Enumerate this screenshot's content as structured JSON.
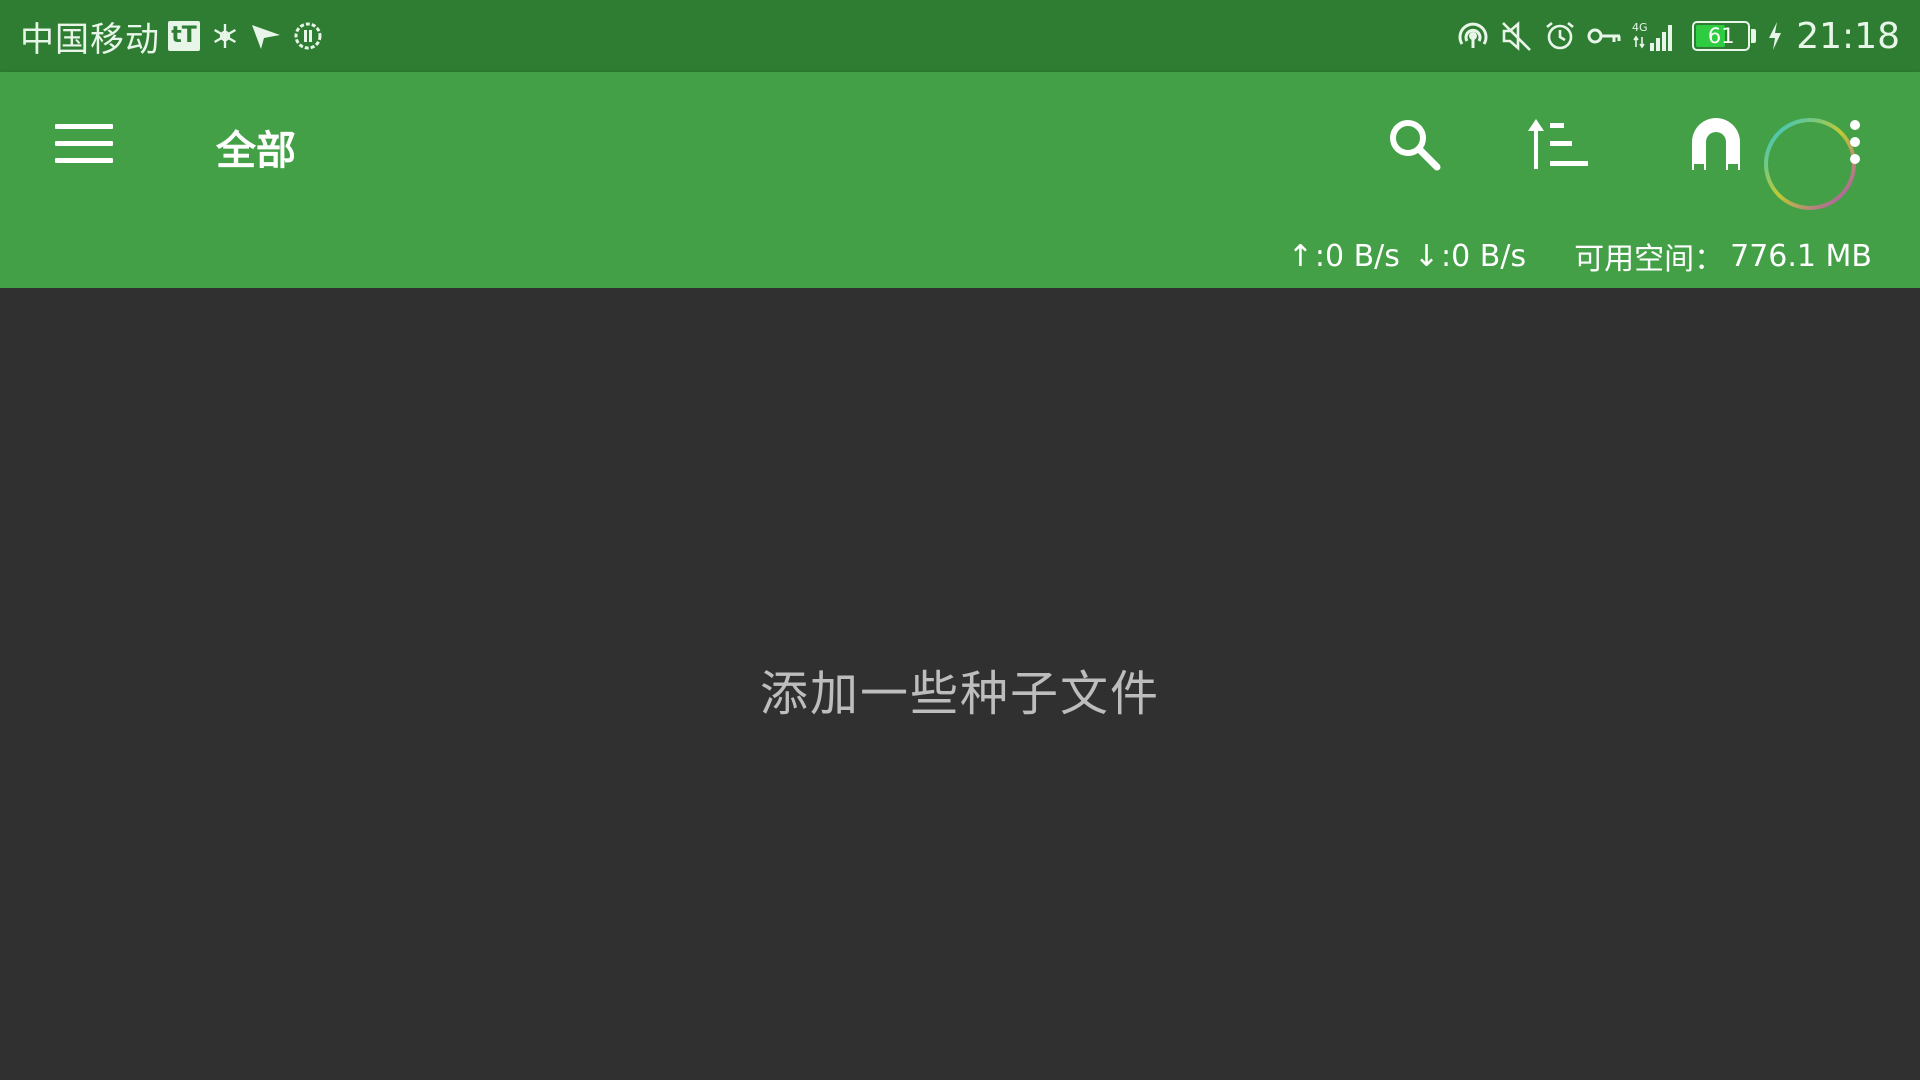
{
  "status_bar": {
    "carrier": "中国移动",
    "badge": "tT",
    "battery_level": "61",
    "battery_fraction": 0.61,
    "time": "21:18",
    "network_type": "4G",
    "left_icons": [
      "tt-app-icon",
      "snowflake-icon",
      "send-icon",
      "pause-circle-icon"
    ],
    "right_icons": [
      "hotspot-icon",
      "mute-icon",
      "alarm-icon",
      "vpn-key-icon",
      "signal-icon",
      "battery-icon",
      "charging-icon"
    ]
  },
  "toolbar": {
    "title": "全部",
    "actions": [
      "menu-icon",
      "search-icon",
      "sort-icon",
      "magnet-icon",
      "more-icon"
    ],
    "upload_speed": ":0 B/s",
    "download_speed": ":0 B/s",
    "free_space_label": "可用空间：",
    "free_space_value": "776.1 MB"
  },
  "main": {
    "empty_message": "添加一些种子文件"
  },
  "colors": {
    "status_bar": "#2e7d32",
    "toolbar": "#43a047",
    "background": "#303030",
    "empty_text": "#bdbdbd"
  }
}
